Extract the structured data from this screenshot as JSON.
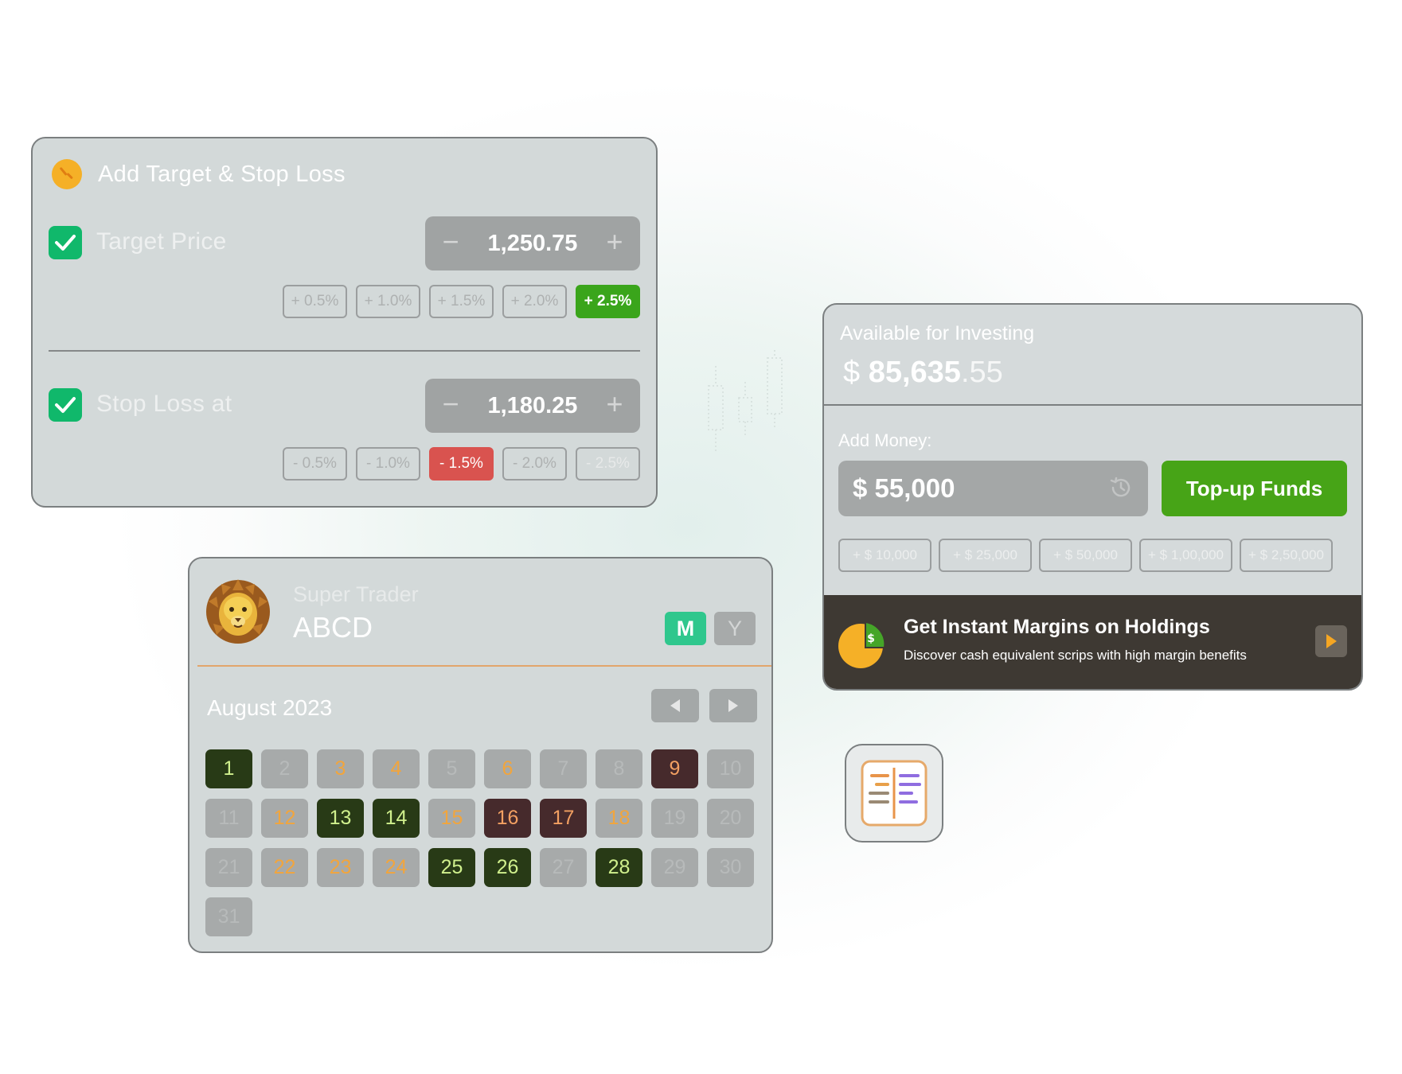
{
  "target_stop_loss": {
    "title": "Add Target & Stop Loss",
    "target": {
      "label": "Target Price",
      "checked": true,
      "value": "1,250.75",
      "minus": "−",
      "plus": "+",
      "chips": [
        "+ 0.5%",
        "+ 1.0%",
        "+ 1.5%",
        "+ 2.0%",
        "+ 2.5%"
      ],
      "selected_chip": "+ 2.5%"
    },
    "stop_loss": {
      "label": "Stop Loss at",
      "checked": true,
      "value": "1,180.25",
      "minus": "−",
      "plus": "+",
      "chips": [
        "- 0.5%",
        "- 1.0%",
        "- 1.5%",
        "- 2.0%",
        "- 2.5%"
      ],
      "selected_chip": "- 1.5%"
    }
  },
  "trader": {
    "subtitle": "Super Trader",
    "name": "ABCD",
    "toggle_m": "M",
    "toggle_y": "Y",
    "month": "August 2023",
    "days": [
      {
        "d": "1",
        "s": "dark-green"
      },
      {
        "d": "2",
        "s": "muted"
      },
      {
        "d": "3",
        "s": "orange"
      },
      {
        "d": "4",
        "s": "orange"
      },
      {
        "d": "5",
        "s": "muted"
      },
      {
        "d": "6",
        "s": "orange"
      },
      {
        "d": "7",
        "s": "muted"
      },
      {
        "d": "8",
        "s": "muted"
      },
      {
        "d": "9",
        "s": "maroon"
      },
      {
        "d": "10",
        "s": "muted"
      },
      {
        "d": "11",
        "s": "muted"
      },
      {
        "d": "12",
        "s": "orange"
      },
      {
        "d": "13",
        "s": "dark-green"
      },
      {
        "d": "14",
        "s": "dark-green"
      },
      {
        "d": "15",
        "s": "orange"
      },
      {
        "d": "16",
        "s": "maroon"
      },
      {
        "d": "17",
        "s": "maroon"
      },
      {
        "d": "18",
        "s": "orange"
      },
      {
        "d": "19",
        "s": "muted"
      },
      {
        "d": "20",
        "s": "muted"
      },
      {
        "d": "21",
        "s": "muted"
      },
      {
        "d": "22",
        "s": "orange"
      },
      {
        "d": "23",
        "s": "orange"
      },
      {
        "d": "24",
        "s": "orange"
      },
      {
        "d": "25",
        "s": "dark-green"
      },
      {
        "d": "26",
        "s": "dark-green"
      },
      {
        "d": "27",
        "s": "muted"
      },
      {
        "d": "28",
        "s": "dark-green"
      },
      {
        "d": "29",
        "s": "muted"
      },
      {
        "d": "30",
        "s": "muted"
      },
      {
        "d": "31",
        "s": "muted"
      }
    ]
  },
  "invest": {
    "label": "Available for Investing",
    "currency": "$",
    "amount_main": "85,635",
    "amount_decimal": ".55",
    "add_money_label": "Add Money:",
    "input_value": "$  55,000",
    "topup_label": "Top-up Funds",
    "amount_chips": [
      "+ $ 10,000",
      "+ $ 25,000",
      "+ $ 50,000",
      "+ $ 1,00,000",
      "+ $ 2,50,000"
    ],
    "promo_title": "Get Instant Margins on Holdings",
    "promo_subtitle": "Discover cash equivalent scrips with high margin benefits",
    "pie_symbol": "$"
  },
  "colors": {
    "accent_green": "#47a417",
    "checkbox_green": "#10b86b",
    "negative_red": "#d9534f",
    "promo_bg": "#3e3933"
  }
}
